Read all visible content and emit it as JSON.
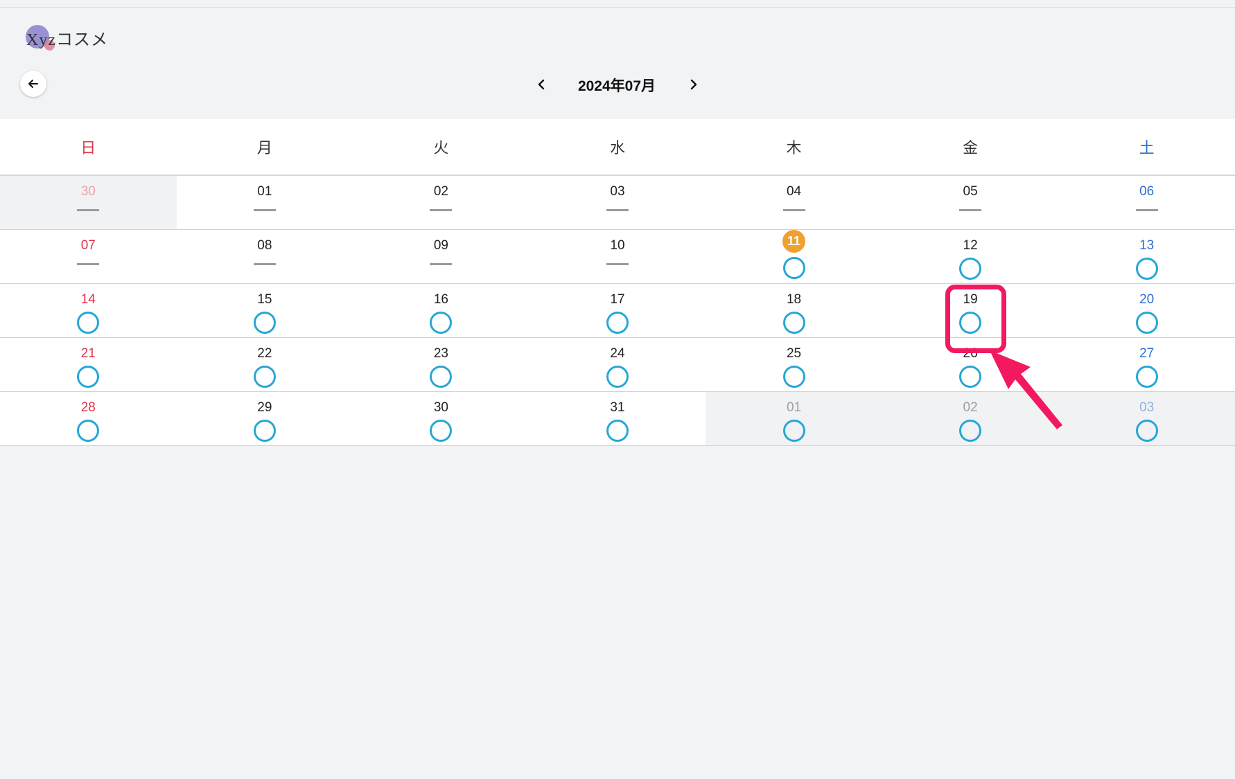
{
  "app": {
    "logo_text": "Xyzコスメ"
  },
  "header": {
    "month_title": "2024年07月"
  },
  "weekdays": [
    "日",
    "月",
    "火",
    "水",
    "木",
    "金",
    "土"
  ],
  "weeks": [
    [
      {
        "day": "30",
        "other": true,
        "mark": "dash"
      },
      {
        "day": "01",
        "other": false,
        "mark": "dash"
      },
      {
        "day": "02",
        "other": false,
        "mark": "dash"
      },
      {
        "day": "03",
        "other": false,
        "mark": "dash"
      },
      {
        "day": "04",
        "other": false,
        "mark": "dash"
      },
      {
        "day": "05",
        "other": false,
        "mark": "dash"
      },
      {
        "day": "06",
        "other": false,
        "mark": "dash"
      }
    ],
    [
      {
        "day": "07",
        "other": false,
        "mark": "dash"
      },
      {
        "day": "08",
        "other": false,
        "mark": "dash"
      },
      {
        "day": "09",
        "other": false,
        "mark": "dash"
      },
      {
        "day": "10",
        "other": false,
        "mark": "dash"
      },
      {
        "day": "11",
        "other": false,
        "mark": "circle",
        "today": true
      },
      {
        "day": "12",
        "other": false,
        "mark": "circle"
      },
      {
        "day": "13",
        "other": false,
        "mark": "circle"
      }
    ],
    [
      {
        "day": "14",
        "other": false,
        "mark": "circle"
      },
      {
        "day": "15",
        "other": false,
        "mark": "circle"
      },
      {
        "day": "16",
        "other": false,
        "mark": "circle"
      },
      {
        "day": "17",
        "other": false,
        "mark": "circle"
      },
      {
        "day": "18",
        "other": false,
        "mark": "circle"
      },
      {
        "day": "19",
        "other": false,
        "mark": "circle",
        "highlighted": true
      },
      {
        "day": "20",
        "other": false,
        "mark": "circle"
      }
    ],
    [
      {
        "day": "21",
        "other": false,
        "mark": "circle"
      },
      {
        "day": "22",
        "other": false,
        "mark": "circle"
      },
      {
        "day": "23",
        "other": false,
        "mark": "circle"
      },
      {
        "day": "24",
        "other": false,
        "mark": "circle"
      },
      {
        "day": "25",
        "other": false,
        "mark": "circle"
      },
      {
        "day": "26",
        "other": false,
        "mark": "circle"
      },
      {
        "day": "27",
        "other": false,
        "mark": "circle"
      }
    ],
    [
      {
        "day": "28",
        "other": false,
        "mark": "circle"
      },
      {
        "day": "29",
        "other": false,
        "mark": "circle"
      },
      {
        "day": "30",
        "other": false,
        "mark": "circle"
      },
      {
        "day": "31",
        "other": false,
        "mark": "circle"
      },
      {
        "day": "01",
        "other": true,
        "mark": "circle"
      },
      {
        "day": "02",
        "other": true,
        "mark": "circle"
      },
      {
        "day": "03",
        "other": true,
        "mark": "circle"
      }
    ]
  ],
  "colors": {
    "sunday": "#e0344b",
    "saturday": "#2c6fd1",
    "available_circle": "#26a7d6",
    "today_badge": "#f0a02c",
    "annotation": "#f2195f"
  },
  "icons": {
    "back": "arrow-left-icon",
    "prev": "chevron-left-icon",
    "next": "chevron-right-icon",
    "available": "circle-icon",
    "unavailable": "dash-icon"
  }
}
